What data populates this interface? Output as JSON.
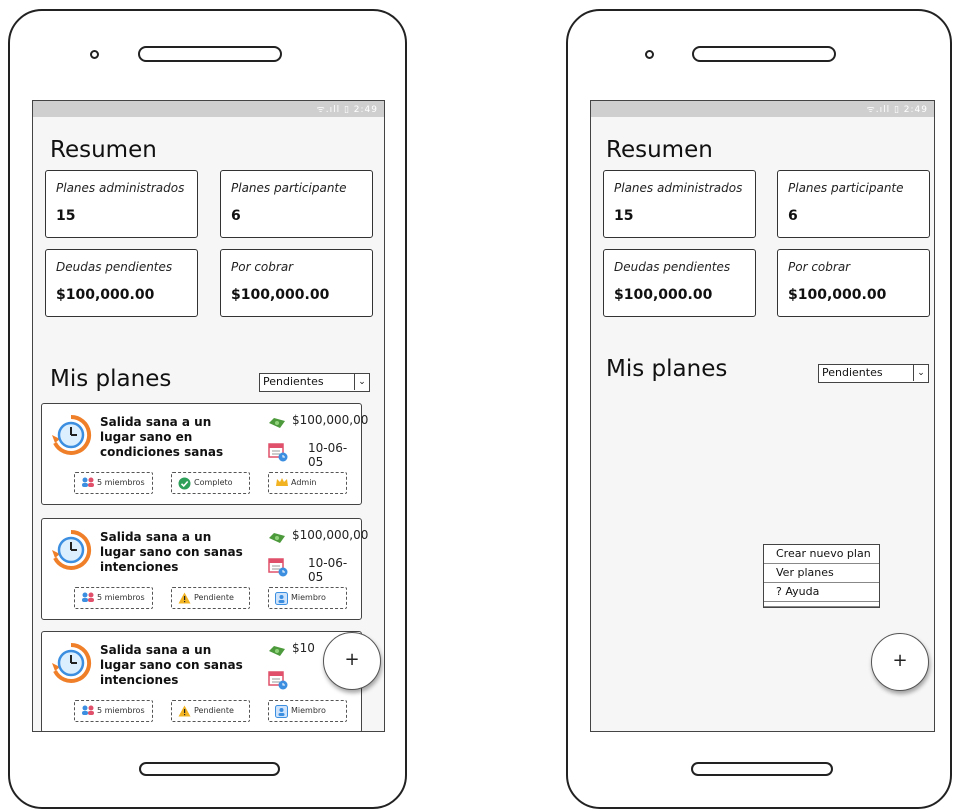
{
  "status_bar": {
    "icons": "ᯤ.ıll ▯ 2:49"
  },
  "summary": {
    "title": "Resumen",
    "cards": [
      {
        "label": "Planes administrados",
        "value": "15"
      },
      {
        "label": "Planes participante",
        "value": "6"
      },
      {
        "label": "Deudas pendientes",
        "value": "$100,000.00"
      },
      {
        "label": "Por cobrar",
        "value": "$100,000.00"
      }
    ]
  },
  "plans": {
    "title": "Mis planes",
    "filter": {
      "selected": "Pendientes"
    },
    "items": [
      {
        "title": "Salida sana a un lugar sano en condiciones sanas",
        "amount": "$100,000,00",
        "date": "10-06-05",
        "tags": [
          {
            "icon": "users-icon",
            "text": "5 miembros"
          },
          {
            "icon": "check-icon",
            "text": "Completo"
          },
          {
            "icon": "crown-icon",
            "text": "Admin"
          }
        ]
      },
      {
        "title": "Salida sana a un lugar sano con sanas intenciones",
        "amount": "$100,000,00",
        "date": "10-06-05",
        "tags": [
          {
            "icon": "users-icon",
            "text": "5 miembros"
          },
          {
            "icon": "warning-icon",
            "text": "Pendiente"
          },
          {
            "icon": "member-icon",
            "text": "Miembro"
          }
        ]
      },
      {
        "title": "Salida sana a un lugar sano con sanas intenciones",
        "amount": "$10",
        "date": "",
        "tags": [
          {
            "icon": "users-icon",
            "text": "5 miembros"
          },
          {
            "icon": "warning-icon",
            "text": "Pendiente"
          },
          {
            "icon": "member-icon",
            "text": "Miembro"
          }
        ]
      }
    ]
  },
  "fab": {
    "label": "+"
  },
  "fab_menu": {
    "items": [
      "Crear nuevo plan",
      "Ver planes",
      "? Ayuda"
    ]
  },
  "colors": {
    "status_bar": "#cfcfcf",
    "screen_bg": "#f6f6f6",
    "clock_orange": "#f07f2a",
    "clock_blue": "#3b8ee0",
    "money_green": "#4c9a3b",
    "calendar_red": "#e0506a",
    "check_green": "#2ea05a",
    "crown_yellow": "#f2b322"
  }
}
